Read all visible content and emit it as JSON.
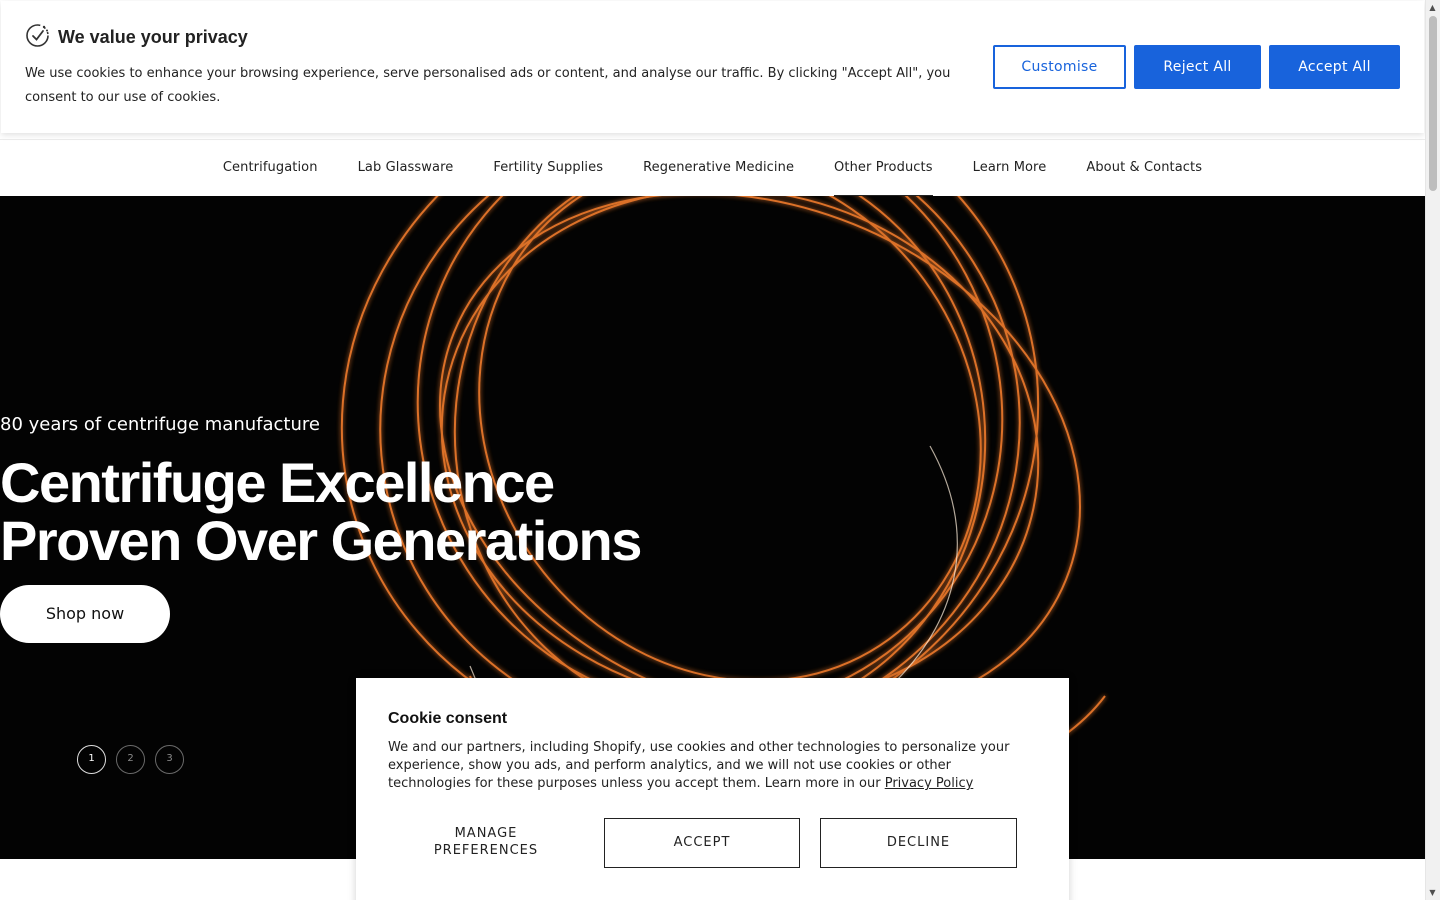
{
  "privacy_banner": {
    "title": "We value your privacy",
    "text": "We use cookies to enhance your browsing experience, serve personalised ads or content, and analyse our traffic. By clicking \"Accept All\", you consent to our use of cookies.",
    "customise_label": "Customise",
    "reject_label": "Reject All",
    "accept_label": "Accept All",
    "accent_color": "#1863dc"
  },
  "nav": {
    "items": [
      {
        "label": "Centrifugation"
      },
      {
        "label": "Lab Glassware"
      },
      {
        "label": "Fertility Supplies"
      },
      {
        "label": "Regenerative Medicine"
      },
      {
        "label": "Other Products",
        "active": true
      },
      {
        "label": "Learn More"
      },
      {
        "label": "About & Contacts"
      }
    ]
  },
  "hero": {
    "eyebrow": "80 years of centrifuge manufacture",
    "title_line1": "Centrifuge Excellence",
    "title_line2": "Proven Over Generations",
    "button_label": "Shop now",
    "slides": [
      "1",
      "2",
      "3"
    ],
    "active_slide": "1",
    "glow_color": "#e8772a"
  },
  "cookie_consent": {
    "title": "Cookie consent",
    "text": "We and our partners, including Shopify, use cookies and other technologies to personalize your experience, show you ads, and perform analytics, and we will not use cookies or other technologies for these purposes unless you accept them. Learn more in our",
    "link_label": "Privacy Policy",
    "manage_line1": "MANAGE",
    "manage_line2": "PREFERENCES",
    "accept_label": "ACCEPT",
    "decline_label": "DECLINE"
  }
}
